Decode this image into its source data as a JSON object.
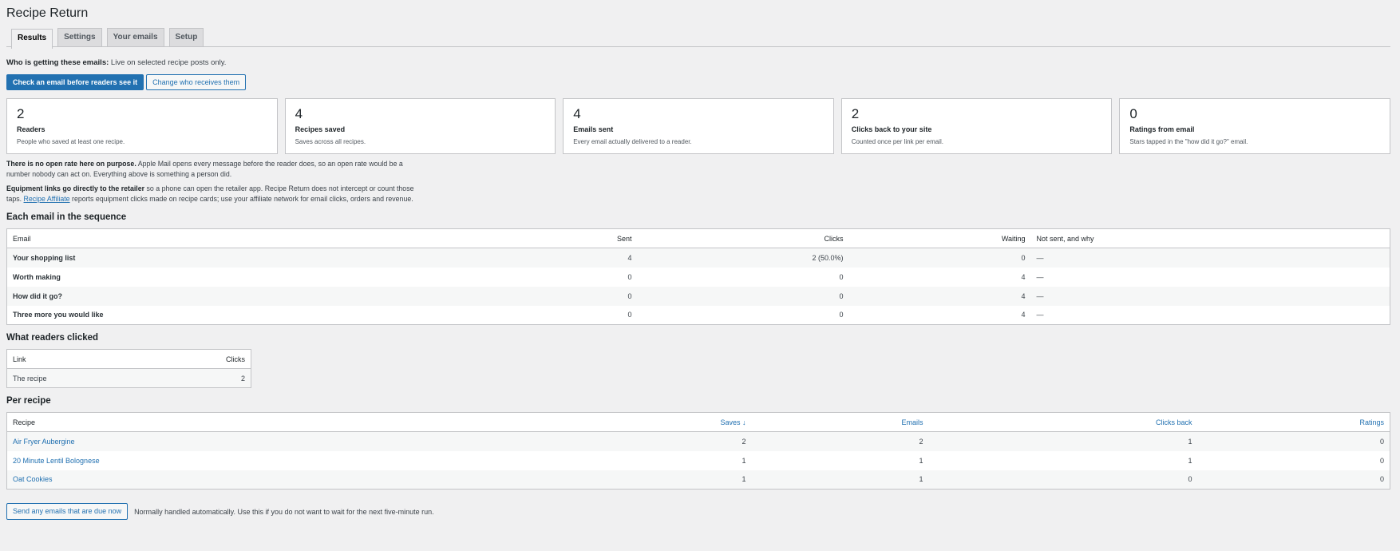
{
  "page": {
    "title": "Recipe Return"
  },
  "tabs": [
    "Results",
    "Settings",
    "Your emails",
    "Setup"
  ],
  "who": {
    "label": "Who is getting these emails:",
    "value": "Live on selected recipe posts only."
  },
  "buttons": {
    "check": "Check an email before readers see it",
    "change": "Change who receives them"
  },
  "cards": [
    {
      "value": "2",
      "label": "Readers",
      "desc": "People who saved at least one recipe."
    },
    {
      "value": "4",
      "label": "Recipes saved",
      "desc": "Saves across all recipes."
    },
    {
      "value": "4",
      "label": "Emails sent",
      "desc": "Every email actually delivered to a reader."
    },
    {
      "value": "2",
      "label": "Clicks back to your site",
      "desc": "Counted once per link per email."
    },
    {
      "value": "0",
      "label": "Ratings from email",
      "desc": "Stars tapped in the \"how did it go?\" email."
    }
  ],
  "notes": {
    "open_bold": "There is no open rate here on purpose.",
    "open_text": "Apple Mail opens every message before the reader does, so an open rate would be a number nobody can act on. Everything above is something a person did.",
    "equip_bold": "Equipment links go directly to the retailer",
    "equip_text1": "so a phone can open the retailer app. Recipe Return does not intercept or count those taps.",
    "equip_link": "Recipe Affiliate",
    "equip_text2": "reports equipment clicks made on recipe cards; use your affiliate network for email clicks, orders and revenue."
  },
  "sequence": {
    "heading": "Each email in the sequence",
    "columns": [
      "Email",
      "Sent",
      "Clicks",
      "Waiting",
      "Not sent, and why"
    ],
    "rows": [
      {
        "email": "Your shopping list",
        "sent": "4",
        "clicks": "2 (50.0%)",
        "waiting": "0",
        "why": "—"
      },
      {
        "email": "Worth making",
        "sent": "0",
        "clicks": "0",
        "waiting": "4",
        "why": "—"
      },
      {
        "email": "How did it go?",
        "sent": "0",
        "clicks": "0",
        "waiting": "4",
        "why": "—"
      },
      {
        "email": "Three more you would like",
        "sent": "0",
        "clicks": "0",
        "waiting": "4",
        "why": "—"
      }
    ]
  },
  "clicked": {
    "heading": "What readers clicked",
    "columns": [
      "Link",
      "Clicks"
    ],
    "rows": [
      {
        "link": "The recipe",
        "clicks": "2"
      }
    ]
  },
  "per_recipe": {
    "heading": "Per recipe",
    "columns": [
      "Recipe",
      "Saves ↓",
      "Emails",
      "Clicks back",
      "Ratings"
    ],
    "rows": [
      {
        "recipe": "Air Fryer Aubergine",
        "saves": "2",
        "emails": "2",
        "clicks_back": "1",
        "ratings": "0"
      },
      {
        "recipe": "20 Minute Lentil Bolognese",
        "saves": "1",
        "emails": "1",
        "clicks_back": "1",
        "ratings": "0"
      },
      {
        "recipe": "Oat Cookies",
        "saves": "1",
        "emails": "1",
        "clicks_back": "0",
        "ratings": "0"
      }
    ]
  },
  "footer": {
    "button": "Send any emails that are due now",
    "note": "Normally handled automatically. Use this if you do not want to wait for the next five-minute run."
  }
}
